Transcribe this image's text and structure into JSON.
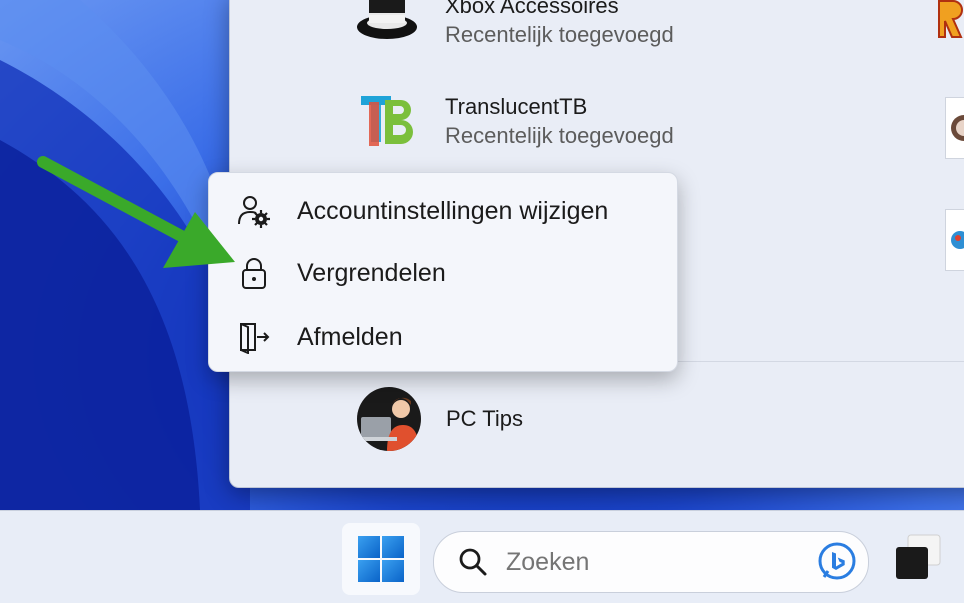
{
  "start_menu": {
    "apps": [
      {
        "name": "Xbox Accessoires",
        "subtitle": "Recentelijk toegevoegd",
        "icon": "xbox-accessories-icon"
      },
      {
        "name": "TranslucentTB",
        "subtitle": "Recentelijk toegevoegd",
        "icon": "translucenttb-icon"
      }
    ],
    "user": {
      "name": "PC Tips"
    }
  },
  "context_menu": {
    "items": [
      {
        "label": "Accountinstellingen wijzigen",
        "icon": "account-settings-icon"
      },
      {
        "label": "Vergrendelen",
        "icon": "lock-icon"
      },
      {
        "label": "Afmelden",
        "icon": "sign-out-icon"
      }
    ]
  },
  "taskbar": {
    "search": {
      "value": "",
      "placeholder": "Zoeken"
    }
  },
  "colors": {
    "arrow": "#3aa92a",
    "windows_blue": "#1c7fe0"
  }
}
